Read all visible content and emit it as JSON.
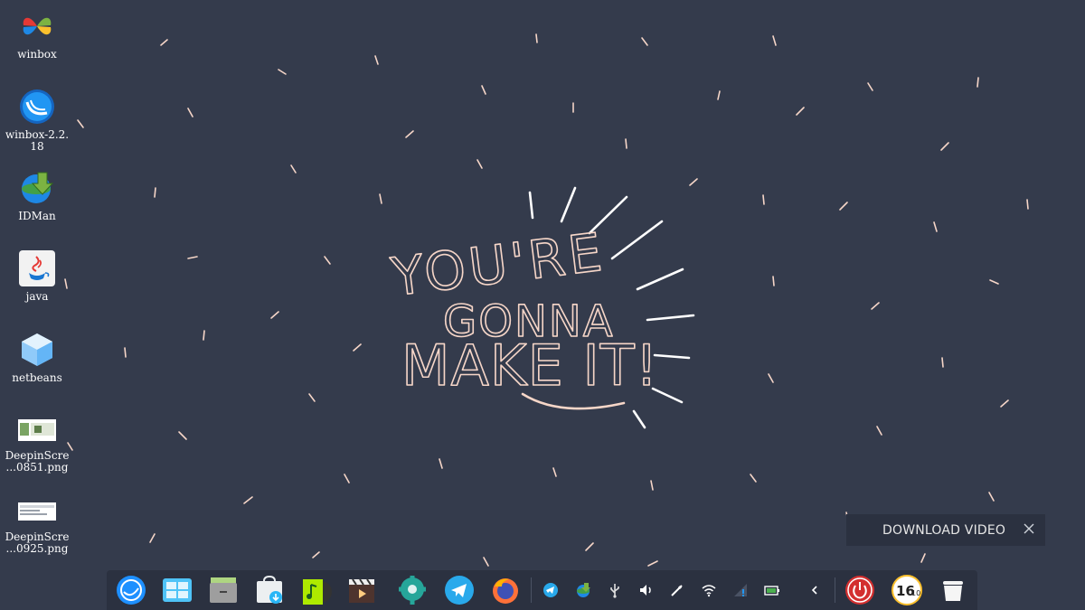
{
  "wallpaper": {
    "line1": "YOU'RE",
    "line2": "GONNA",
    "line3": "MAKE IT!",
    "background_color": "#343b4c",
    "ink_color": "#f6d6c8"
  },
  "desktop_icons": [
    {
      "label": "winbox",
      "icon": "winbox-icon"
    },
    {
      "label": "winbox-2.2.\n18",
      "icon": "winbox-2-icon"
    },
    {
      "label": "IDMan",
      "icon": "idman-icon"
    },
    {
      "label": "java",
      "icon": "java-icon"
    },
    {
      "label": "netbeans",
      "icon": "netbeans-icon"
    },
    {
      "label": "DeepinScre\n...0851.png",
      "icon": "screenshot-thumbnail-icon"
    },
    {
      "label": "DeepinScre\n...0925.png",
      "icon": "screenshot-thumbnail-icon"
    }
  ],
  "dock": {
    "apps": [
      "launcher-icon",
      "multitasking-view-icon",
      "file-manager-icon",
      "app-store-icon",
      "music-icon",
      "movie-icon",
      "control-center-icon",
      "telegram-icon",
      "firefox-icon"
    ],
    "tray": [
      "telegram-tray-icon",
      "idm-tray-icon",
      "usb-icon",
      "volume-icon",
      "pen-icon",
      "wifi-icon",
      "network-icon",
      "battery-icon",
      "collapse-arrow-icon"
    ],
    "clock": {
      "hours": "16",
      "minutes": "10"
    }
  },
  "notification": {
    "text": "DOWNLOAD VIDEO",
    "close_icon": "close-icon"
  }
}
